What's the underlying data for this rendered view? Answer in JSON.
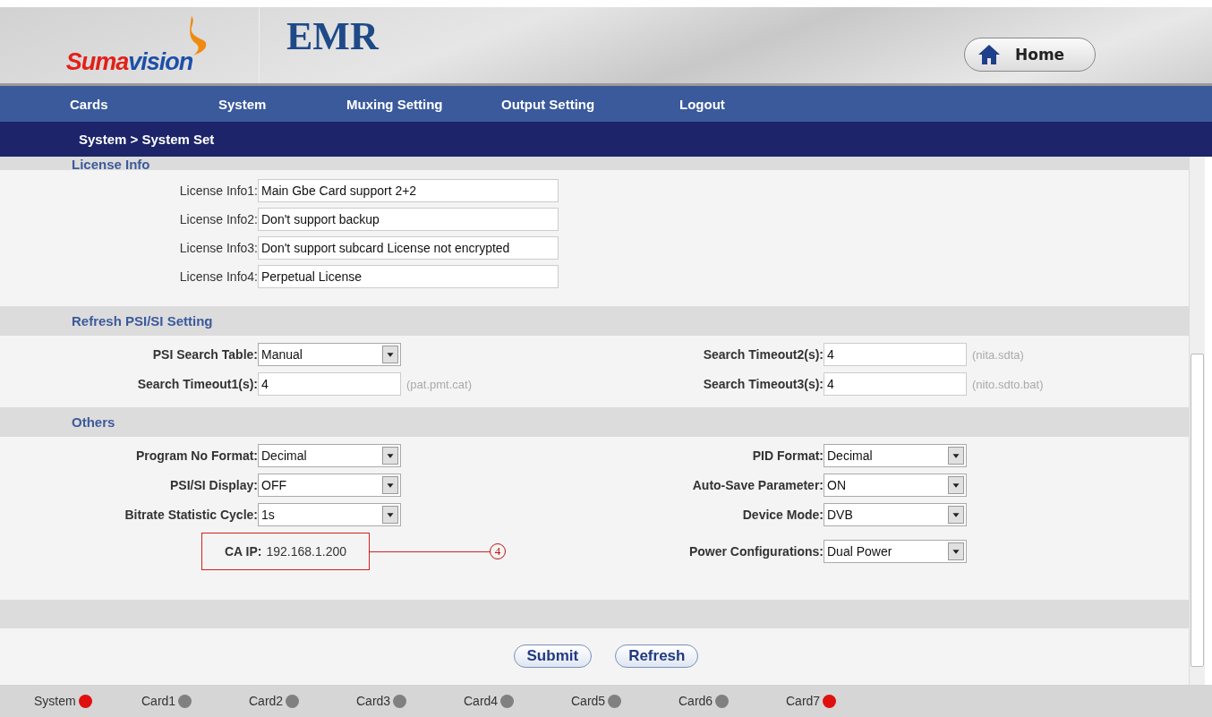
{
  "header": {
    "logo_first": "Suma",
    "logo_second": "vision",
    "product": "EMR",
    "home_button": "Home"
  },
  "nav": [
    "Cards",
    "System",
    "Muxing Setting",
    "Output Setting",
    "Logout"
  ],
  "breadcrumb": "System > System Set",
  "sections": [
    {
      "title": "License Info",
      "kind": "license",
      "rows": [
        {
          "label": "License Info1:",
          "value": "Main Gbe Card support 2+2"
        },
        {
          "label": "License Info2:",
          "value": "Don't support backup"
        },
        {
          "label": "License Info3:",
          "value": "Don't support subcard License not encrypted"
        },
        {
          "label": "License Info4:",
          "value": "Perpetual License"
        }
      ]
    },
    {
      "title": "Refresh PSI/SI Setting",
      "kind": "grid",
      "rows": [
        {
          "left": {
            "kind": "select",
            "label": "PSI Search Table:",
            "value": "Manual"
          },
          "right": {
            "kind": "input",
            "label": "Search Timeout2(s):",
            "value": "4",
            "hint": "(nita.sdta)"
          }
        },
        {
          "left": {
            "kind": "input",
            "label": "Search Timeout1(s):",
            "value": "4",
            "hint": "(pat.pmt.cat)"
          },
          "right": {
            "kind": "input",
            "label": "Search Timeout3(s):",
            "value": "4",
            "hint": "(nito.sdto.bat)"
          }
        }
      ]
    },
    {
      "title": "Others",
      "kind": "grid",
      "rows": [
        {
          "left": {
            "kind": "select",
            "label": "Program No Format:",
            "value": "Decimal"
          },
          "right": {
            "kind": "select",
            "label": "PID Format:",
            "value": "Decimal"
          }
        },
        {
          "left": {
            "kind": "select",
            "label": "PSI/SI Display:",
            "value": "OFF"
          },
          "right": {
            "kind": "select",
            "label": "Auto-Save Parameter:",
            "value": "ON"
          }
        },
        {
          "left": {
            "kind": "select",
            "label": "Bitrate Statistic Cycle:",
            "value": "1s"
          },
          "right": {
            "kind": "select",
            "label": "Device Mode:",
            "value": "DVB"
          }
        },
        {
          "left": {
            "kind": "annotated",
            "label": "CA IP:",
            "value": "192.168.1.200",
            "callout": "4"
          },
          "right": {
            "kind": "select",
            "label": "Power Configurations:",
            "value": "Dual Power"
          }
        }
      ]
    }
  ],
  "buttons": [
    "Submit",
    "Refresh"
  ],
  "status": [
    {
      "label": "System",
      "color": "#e01010"
    },
    {
      "label": "Card1",
      "color": "#808080"
    },
    {
      "label": "Card2",
      "color": "#808080"
    },
    {
      "label": "Card3",
      "color": "#808080"
    },
    {
      "label": "Card4",
      "color": "#808080"
    },
    {
      "label": "Card5",
      "color": "#808080"
    },
    {
      "label": "Card6",
      "color": "#808080"
    },
    {
      "label": "Card7",
      "color": "#e01010"
    }
  ]
}
